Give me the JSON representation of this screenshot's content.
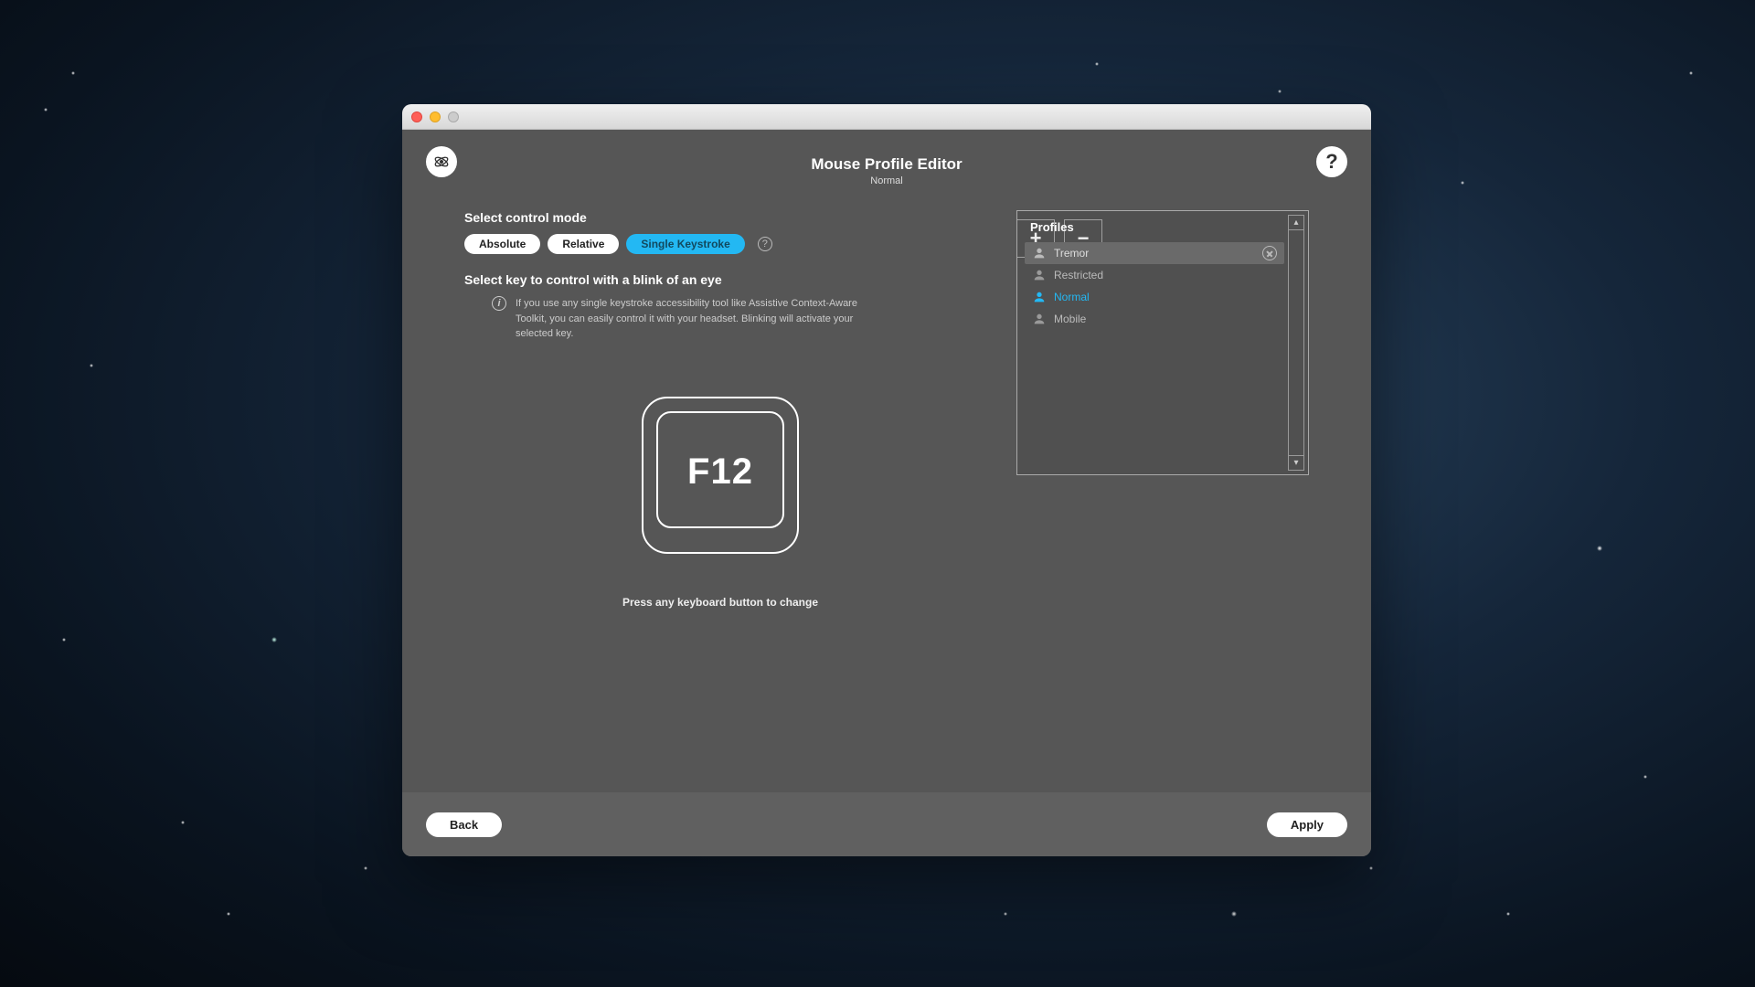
{
  "header": {
    "title": "Mouse Profile Editor",
    "subtitle": "Normal"
  },
  "labels": {
    "select_mode": "Select control mode",
    "select_key": "Select key to control with a blink of an eye",
    "info": "If you use any single keystroke accessibility tool like Assistive Context-Aware Toolkit, you can easily control it with your headset. Blinking will activate your selected key.",
    "press_hint": "Press any keyboard button to change"
  },
  "modes": {
    "absolute": "Absolute",
    "relative": "Relative",
    "single": "Single Keystroke"
  },
  "key": {
    "current": "F12"
  },
  "profiles": {
    "title": "Profiles",
    "items": [
      {
        "name": "Tremor",
        "hovered": true,
        "active": false
      },
      {
        "name": "Restricted",
        "hovered": false,
        "active": false
      },
      {
        "name": "Normal",
        "hovered": false,
        "active": true
      },
      {
        "name": "Mobile",
        "hovered": false,
        "active": false
      }
    ],
    "add": "+",
    "remove": "−"
  },
  "footer": {
    "back": "Back",
    "apply": "Apply"
  },
  "help": "?"
}
